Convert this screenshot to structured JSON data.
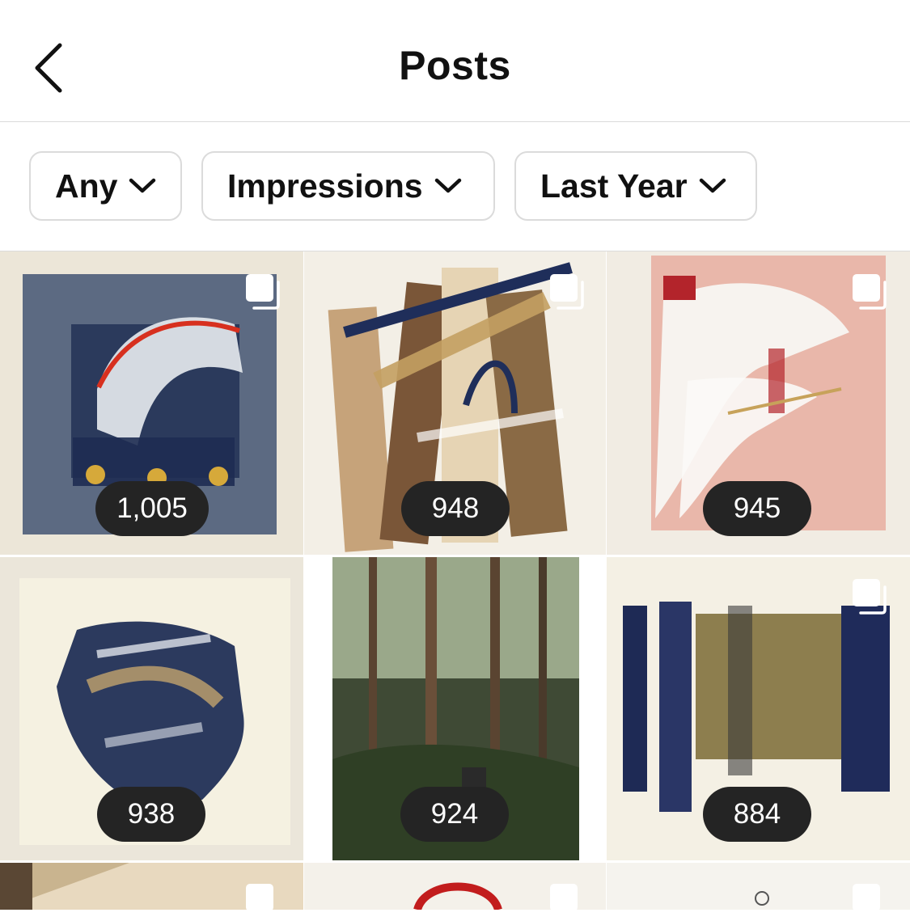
{
  "header": {
    "title": "Posts",
    "back_icon": "chevron-left-icon"
  },
  "filters": [
    {
      "label": "Any",
      "icon": "chevron-down-icon"
    },
    {
      "label": "Impressions",
      "icon": "chevron-down-icon"
    },
    {
      "label": "Last Year",
      "icon": "chevron-down-icon"
    }
  ],
  "posts": [
    {
      "impressions": "1,005",
      "multi_photo": true
    },
    {
      "impressions": "948",
      "multi_photo": true
    },
    {
      "impressions": "945",
      "multi_photo": true
    },
    {
      "impressions": "938",
      "multi_photo": false
    },
    {
      "impressions": "924",
      "multi_photo": false
    },
    {
      "impressions": "884",
      "multi_photo": true
    },
    {
      "impressions": "",
      "multi_photo": true
    },
    {
      "impressions": "",
      "multi_photo": true
    },
    {
      "impressions": "",
      "multi_photo": true
    }
  ],
  "colors": {
    "badge_bg": "#242424",
    "divider": "#dbdbdb",
    "text": "#111111"
  }
}
